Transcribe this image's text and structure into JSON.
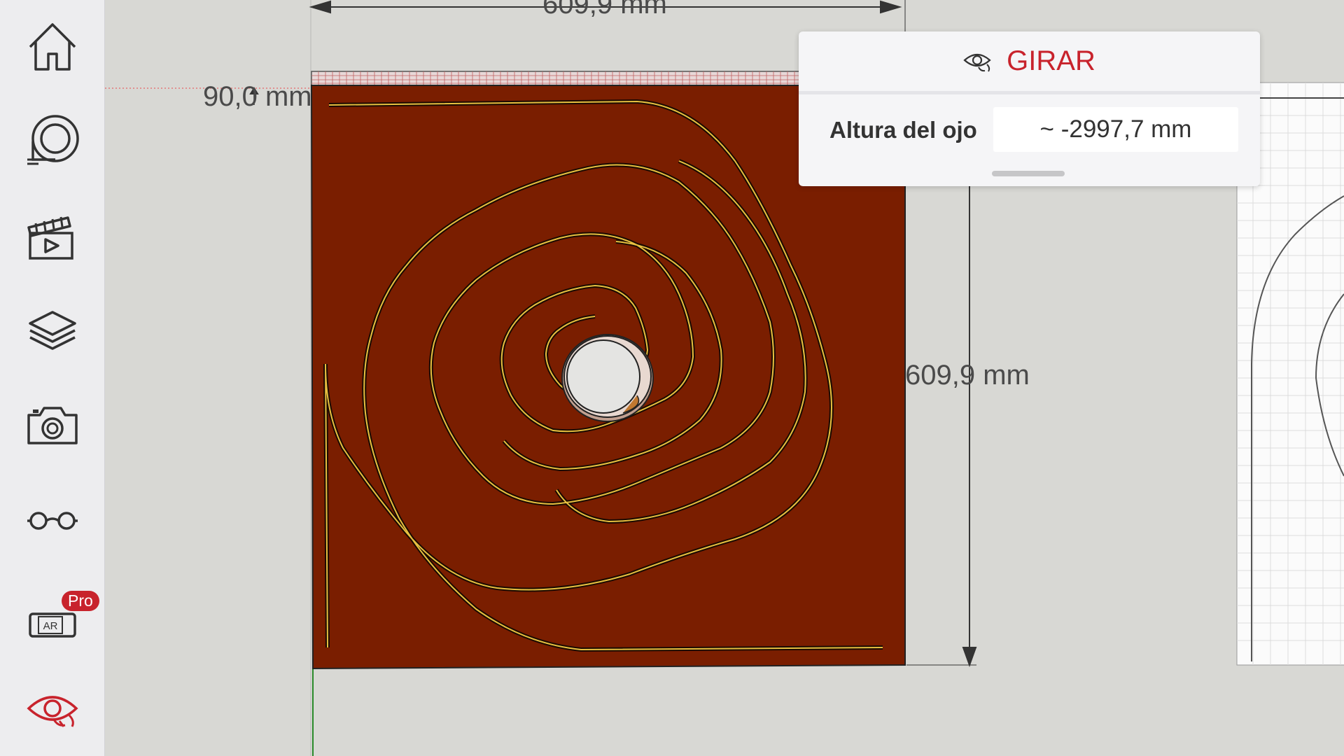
{
  "sidebar": {
    "items": [
      {
        "icon": "home-icon"
      },
      {
        "icon": "tape-measure-icon"
      },
      {
        "icon": "scenes-icon"
      },
      {
        "icon": "layers-icon"
      },
      {
        "icon": "camera-icon"
      },
      {
        "icon": "glasses-icon"
      },
      {
        "icon": "ar-viewer-icon",
        "badge": "Pro"
      },
      {
        "icon": "look-around-icon",
        "active": true
      }
    ],
    "accent_color": "#c8232c"
  },
  "model": {
    "dimensions": {
      "width": "609,9 mm",
      "height": "609,9 mm",
      "offset": "90,0 mm"
    },
    "colors": {
      "panel_fill": "#7a1e00",
      "groove_line": "#e8c040"
    }
  },
  "look_panel": {
    "title": "GIRAR",
    "eye_height_label": "Altura del ojo",
    "eye_height_value": "~ -2997,7 mm"
  }
}
